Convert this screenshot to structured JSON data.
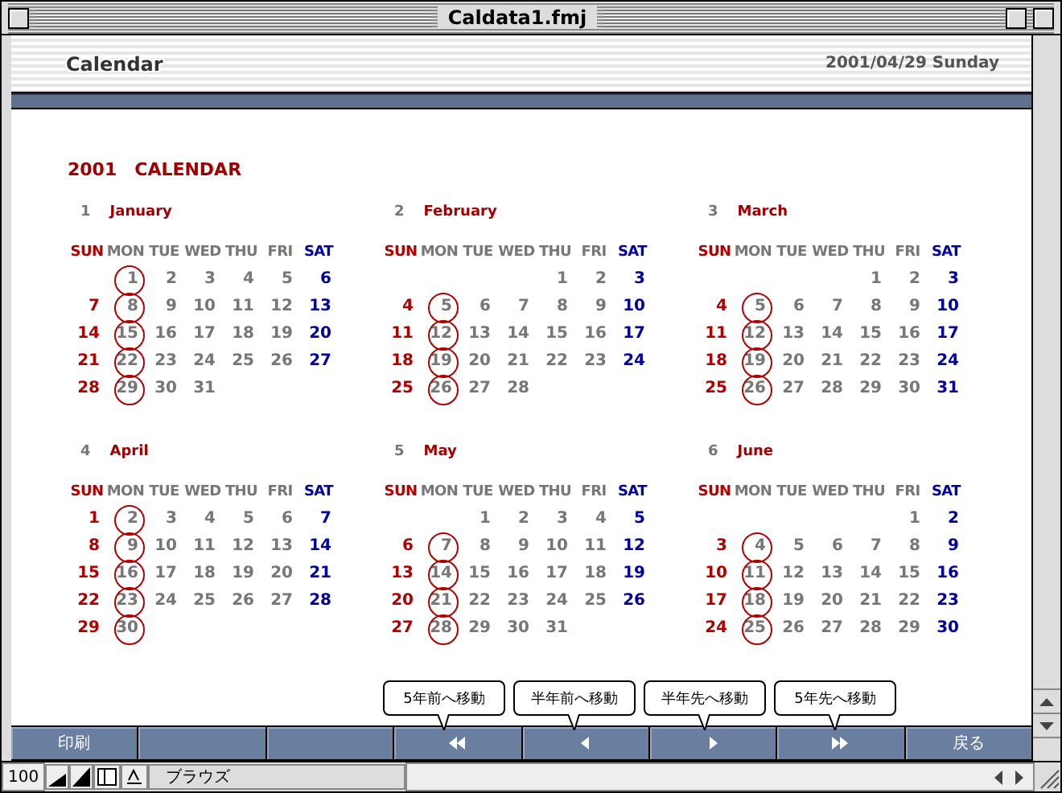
{
  "window": {
    "title": "Caldata1.fmj"
  },
  "header": {
    "title": "Calendar",
    "date": "2001/04/29 Sunday"
  },
  "heading": "2001　CALENDAR",
  "columns": [
    {
      "kind": "sunday"
    },
    {
      "kind": "weekday",
      "circled": true
    },
    {
      "kind": "weekday"
    },
    {
      "kind": "weekday"
    },
    {
      "kind": "weekday"
    },
    {
      "kind": "weekday"
    },
    {
      "kind": "saturday"
    }
  ],
  "months": [
    {
      "number": "1",
      "name": "January",
      "headers": [
        "SUN",
        "MON",
        "TUE",
        "WED",
        "THU",
        "FRI",
        "SAT"
      ],
      "weeks": [
        [
          "1",
          "2",
          "3",
          "4",
          "5",
          "6"
        ],
        [
          "7",
          "8",
          "9",
          "10",
          "11",
          "12",
          "13"
        ],
        [
          "14",
          "15",
          "16",
          "17",
          "18",
          "19",
          "20"
        ],
        [
          "21",
          "22",
          "23",
          "24",
          "25",
          "26",
          "27"
        ],
        [
          "28",
          "29",
          "30",
          "31"
        ]
      ]
    },
    {
      "number": "2",
      "name": "February",
      "headers": [
        "SUN",
        "MON",
        "TUE",
        "WED",
        "THU",
        "FRI",
        "SAT"
      ],
      "weeks": [
        [
          "1",
          "2",
          "3"
        ],
        [
          "4",
          "5",
          "6",
          "7",
          "8",
          "9",
          "10"
        ],
        [
          "11",
          "12",
          "13",
          "14",
          "15",
          "16",
          "17"
        ],
        [
          "18",
          "19",
          "20",
          "21",
          "22",
          "23",
          "24"
        ],
        [
          "25",
          "26",
          "27",
          "28"
        ]
      ]
    },
    {
      "number": "3",
      "name": "March",
      "headers": [
        "SUN",
        "MON",
        "TUE",
        "WED",
        "THU",
        "FRI",
        "SAT"
      ],
      "weeks": [
        [
          "1",
          "2",
          "3"
        ],
        [
          "4",
          "5",
          "6",
          "7",
          "8",
          "9",
          "10"
        ],
        [
          "11",
          "12",
          "13",
          "14",
          "15",
          "16",
          "17"
        ],
        [
          "18",
          "19",
          "20",
          "21",
          "22",
          "23",
          "24"
        ],
        [
          "25",
          "26",
          "27",
          "28",
          "29",
          "30",
          "31"
        ]
      ]
    },
    {
      "number": "4",
      "name": "April",
      "headers": [
        "SUN",
        "MON",
        "TUE",
        "WED",
        "THU",
        "FRI",
        "SAT"
      ],
      "weeks": [
        [
          "1",
          "2",
          "3",
          "4",
          "5",
          "6",
          "7"
        ],
        [
          "8",
          "9",
          "10",
          "11",
          "12",
          "13",
          "14"
        ],
        [
          "15",
          "16",
          "17",
          "18",
          "19",
          "20",
          "21"
        ],
        [
          "22",
          "23",
          "24",
          "25",
          "26",
          "27",
          "28"
        ],
        [
          "29",
          "30"
        ]
      ]
    },
    {
      "number": "5",
      "name": "May",
      "headers": [
        "SUN",
        "MON",
        "TUE",
        "WED",
        "THU",
        "FRI",
        "SAT"
      ],
      "weeks": [
        [
          "1",
          "2",
          "3",
          "4",
          "5"
        ],
        [
          "6",
          "7",
          "8",
          "9",
          "10",
          "11",
          "12"
        ],
        [
          "13",
          "14",
          "15",
          "16",
          "17",
          "18",
          "19"
        ],
        [
          "20",
          "21",
          "22",
          "23",
          "24",
          "25",
          "26"
        ],
        [
          "27",
          "28",
          "29",
          "30",
          "31"
        ]
      ]
    },
    {
      "number": "6",
      "name": "June",
      "headers": [
        "SUN",
        "MON",
        "TUE",
        "WED",
        "THU",
        "FRI",
        "SAT"
      ],
      "weeks": [
        [
          "1",
          "2"
        ],
        [
          "3",
          "4",
          "5",
          "6",
          "7",
          "8",
          "9"
        ],
        [
          "10",
          "11",
          "12",
          "13",
          "14",
          "15",
          "16"
        ],
        [
          "17",
          "18",
          "19",
          "20",
          "21",
          "22",
          "23"
        ],
        [
          "24",
          "25",
          "26",
          "27",
          "28",
          "29",
          "30"
        ]
      ]
    }
  ],
  "buttons": [
    {
      "kind": "text",
      "label": "印刷"
    },
    {
      "kind": "blank"
    },
    {
      "kind": "blank"
    },
    {
      "kind": "rewind",
      "tooltip": "5年前へ移動"
    },
    {
      "kind": "back",
      "tooltip": "半年前へ移動"
    },
    {
      "kind": "forward",
      "tooltip": "半年先へ移動"
    },
    {
      "kind": "fastforward",
      "tooltip": "5年先へ移動"
    },
    {
      "kind": "text",
      "label": "戻る"
    }
  ],
  "status_bar": {
    "zoom": "100",
    "mode": "ブラウズ"
  }
}
